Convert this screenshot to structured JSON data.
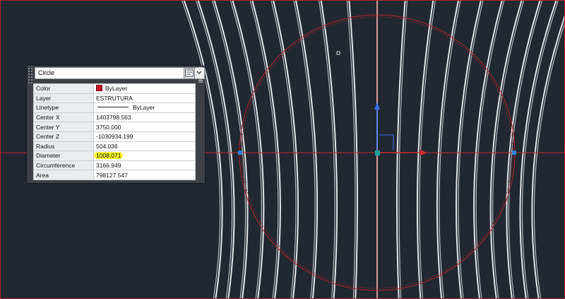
{
  "quick_properties": {
    "object_type": "Circle",
    "rows": [
      {
        "label": "Color",
        "value": "ByLayer",
        "color_swatch": "#c8102e"
      },
      {
        "label": "Layer",
        "value": "ESTRUTURA"
      },
      {
        "label": "Linetype",
        "value": "ByLayer"
      },
      {
        "label": "Center X",
        "value": "1403798.563"
      },
      {
        "label": "Center Y",
        "value": "3750.000"
      },
      {
        "label": "Center Z",
        "value": "-1030934.199"
      },
      {
        "label": "Radius",
        "value": "504.036"
      },
      {
        "label": "Diameter",
        "value": "1008.071",
        "highlighted": true
      },
      {
        "label": "Circumference",
        "value": "3166.949"
      },
      {
        "label": "Area",
        "value": "798127.547"
      }
    ],
    "close_glyph": "×"
  },
  "icons": {
    "dropdown": "chevron-down-icon",
    "palette_toggle": "properties-icon",
    "close": "close-icon",
    "menu": "menu-icon"
  },
  "colors": {
    "canvas_background": "#212830",
    "selected_circle": "#b3232a",
    "crosshair": "#c22a30",
    "highlight": "#f7f224",
    "grip": "#2f7fe0",
    "ucs_y": "#3b6ff0",
    "ucs_x": "#d02a2a",
    "ucs_origin": "#1aa0a0"
  }
}
